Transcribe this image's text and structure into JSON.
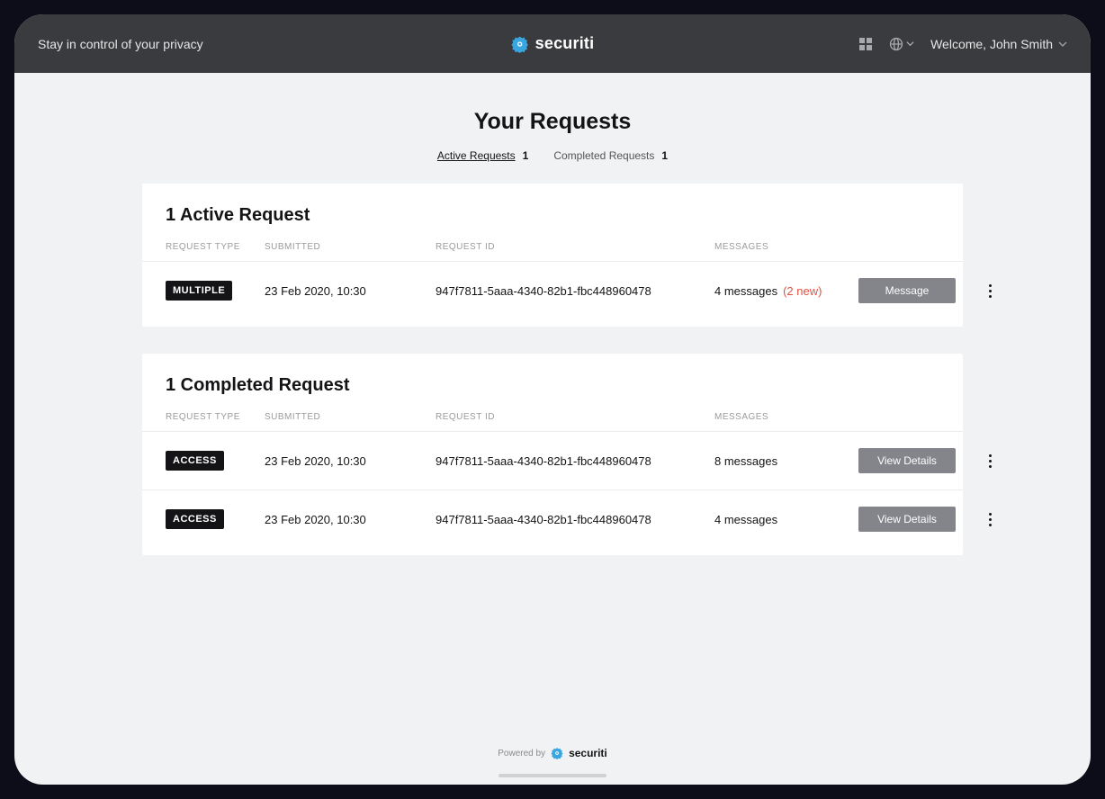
{
  "header": {
    "tagline": "Stay in control of your privacy",
    "brand": "securiti",
    "welcome": "Welcome, John Smith"
  },
  "page": {
    "title": "Your Requests",
    "tabs": {
      "active": {
        "label": "Active Requests",
        "count": "1"
      },
      "completed": {
        "label": "Completed Requests",
        "count": "1"
      }
    }
  },
  "columns": {
    "type": "REQUEST TYPE",
    "submitted": "SUBMITTED",
    "id": "REQUEST ID",
    "messages": "MESSAGES"
  },
  "active": {
    "title": "1 Active Request",
    "rows": [
      {
        "badge": "MULTIPLE",
        "submitted": "23 Feb 2020, 10:30",
        "id": "947f7811-5aaa-4340-82b1-fbc448960478",
        "messages": "4 messages",
        "messages_new": "(2 new)",
        "button": "Message"
      }
    ]
  },
  "completed": {
    "title": "1 Completed Request",
    "rows": [
      {
        "badge": "ACCESS",
        "submitted": "23 Feb 2020, 10:30",
        "id": "947f7811-5aaa-4340-82b1-fbc448960478",
        "messages": "8 messages",
        "button": "View Details"
      },
      {
        "badge": "ACCESS",
        "submitted": "23 Feb 2020, 10:30",
        "id": "947f7811-5aaa-4340-82b1-fbc448960478",
        "messages": "4 messages",
        "button": "View Details"
      }
    ]
  },
  "footer": {
    "powered": "Powered by",
    "brand": "securiti"
  }
}
